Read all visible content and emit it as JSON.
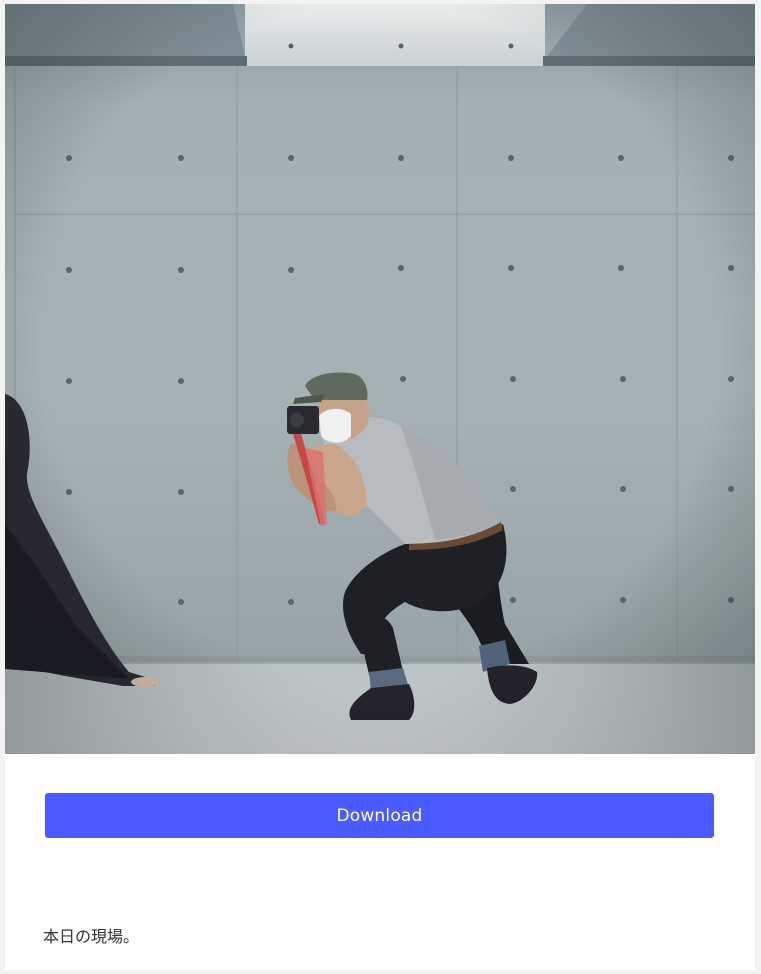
{
  "photo": {
    "subject": "photo"
  },
  "download": {
    "label": "Download",
    "color": "#4a5cff"
  },
  "caption": {
    "text": "本日の現場。"
  }
}
